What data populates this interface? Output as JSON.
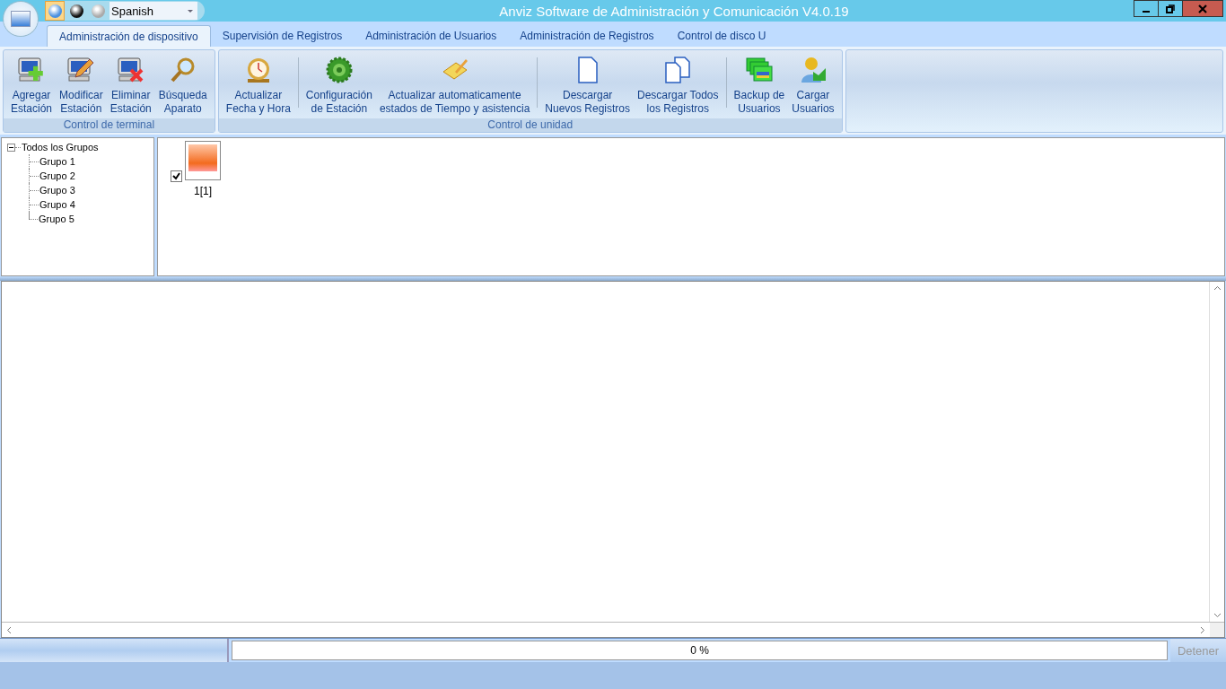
{
  "window": {
    "title": "Anviz Software de Administración y Comunicación V4.0.19"
  },
  "theme_buttons": [
    {
      "selected": true
    },
    {
      "selected": false
    },
    {
      "selected": false
    }
  ],
  "language": {
    "value": "Spanish"
  },
  "tabs": [
    {
      "label": "Administración de dispositivo",
      "selected": true
    },
    {
      "label": "Supervisión de Registros",
      "selected": false
    },
    {
      "label": "Administración de Usuarios",
      "selected": false
    },
    {
      "label": "Administración de Registros",
      "selected": false
    },
    {
      "label": "Control de disco U",
      "selected": false
    }
  ],
  "ribbon_groups": [
    {
      "title": "Control de terminal",
      "buttons": [
        {
          "label": "Agregar\nEstación",
          "separator_before": false
        },
        {
          "label": "Modificar\nEstación",
          "separator_before": false
        },
        {
          "label": "Eliminar\nEstación",
          "separator_before": false
        },
        {
          "label": "Búsqueda\nAparato",
          "separator_before": false
        }
      ]
    },
    {
      "title": "Control de unidad",
      "buttons": [
        {
          "label": "Actualizar\nFecha y Hora",
          "separator_before": false
        },
        {
          "label": "Configuración\nde Estación",
          "separator_before": true
        },
        {
          "label": "Actualizar automaticamente\nestados de Tiempo y asistencia",
          "separator_before": false
        },
        {
          "label": "Descargar\nNuevos Registros",
          "separator_before": true
        },
        {
          "label": "Descargar Todos\nlos Registros",
          "separator_before": false
        },
        {
          "label": "Backup de\nUsuarios",
          "separator_before": true
        },
        {
          "label": "Cargar\nUsuarios",
          "separator_before": false
        }
      ]
    }
  ],
  "tree": {
    "label": "Todos los Grupos",
    "expanded": true,
    "children": [
      {
        "label": "Grupo 1"
      },
      {
        "label": "Grupo 2"
      },
      {
        "label": "Grupo 3"
      },
      {
        "label": "Grupo 4"
      },
      {
        "label": "Grupo 5"
      }
    ]
  },
  "devices": [
    {
      "label": "1[1]",
      "checked": true
    }
  ],
  "status_bar": {
    "progress": {
      "level": 0,
      "reading": "0 %"
    },
    "stop_button": {
      "label": "Detener",
      "disabled": true
    }
  }
}
